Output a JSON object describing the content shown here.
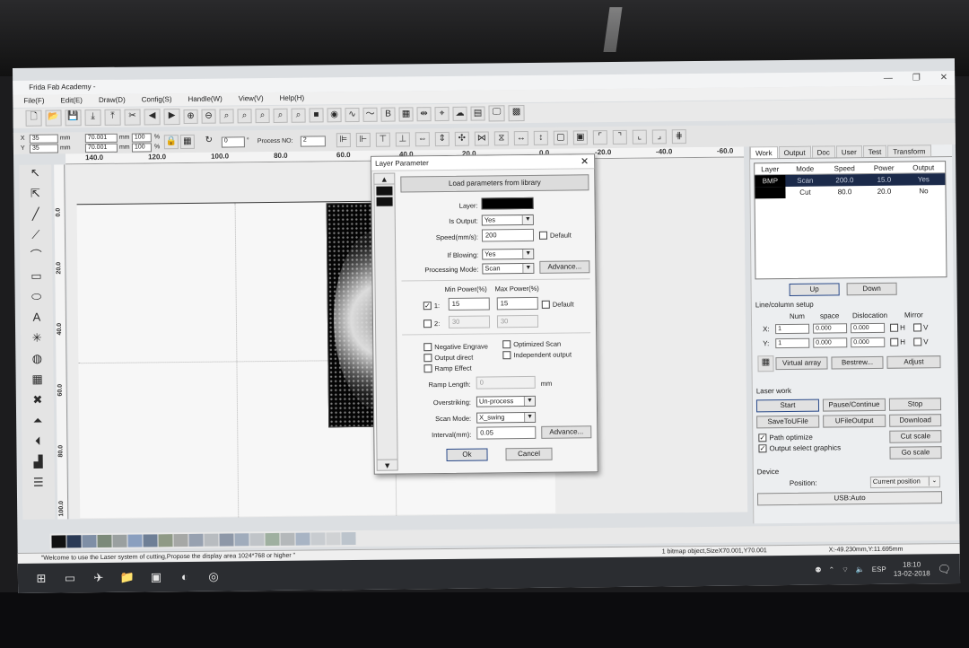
{
  "window": {
    "title": "Frida Fab Academy -"
  },
  "menu": [
    "File(F)",
    "Edit(E)",
    "Draw(D)",
    "Config(S)",
    "Handle(W)",
    "View(V)",
    "Help(H)"
  ],
  "coords": {
    "x_label": "X",
    "y_label": "Y",
    "x": "35",
    "y": "35",
    "unit": "mm",
    "w": "70.001",
    "h": "70.001",
    "pct_w": "100",
    "pct_h": "100",
    "pct": "%",
    "rotate": "0",
    "deg": "°",
    "process_label": "Process NO:",
    "process_no": "2"
  },
  "hruler": [
    "140.0",
    "120.0",
    "100.0",
    "80.0",
    "60.0",
    "40.0",
    "20.0",
    "0.0",
    "-20.0",
    "-40.0",
    "-60.0"
  ],
  "vruler": [
    "0.0",
    "20.0",
    "40.0",
    "60.0",
    "80.0",
    "100.0"
  ],
  "dialog": {
    "title": "Layer Parameter",
    "load_btn": "Load parameters from library",
    "layer_label": "Layer:",
    "is_output_label": "Is Output:",
    "is_output": "Yes",
    "speed_label": "Speed(mm/s):",
    "speed": "200",
    "default_label": "Default",
    "blowing_label": "If Blowing:",
    "blowing": "Yes",
    "mode_label": "Processing Mode:",
    "mode": "Scan",
    "advance": "Advance...",
    "min_power_label": "Min Power(%)",
    "max_power_label": "Max Power(%)",
    "row1_label": "1:",
    "min1": "15",
    "max1": "15",
    "row2_label": "2:",
    "min2": "30",
    "max2": "30",
    "negative": "Negative Engrave",
    "optimized": "Optimized Scan",
    "output_direct": "Output direct",
    "independent": "Independent output",
    "ramp_effect": "Ramp Effect",
    "ramp_length_label": "Ramp Length:",
    "ramp_length": "0",
    "mm": "mm",
    "overstriking_label": "Overstriking:",
    "overstriking": "Un-process",
    "scan_mode_label": "Scan Mode:",
    "scan_mode": "X_swing",
    "interval_label": "Interval(mm):",
    "interval": "0.05",
    "ok": "Ok",
    "cancel": "Cancel"
  },
  "right_panel": {
    "tabs": [
      "Work",
      "Output",
      "Doc",
      "User",
      "Test",
      "Transform"
    ],
    "table_headers": [
      "Layer",
      "Mode",
      "Speed",
      "Power",
      "Output"
    ],
    "rows": [
      {
        "layer": "BMP",
        "mode": "Scan",
        "speed": "200.0",
        "power": "15.0",
        "output": "Yes"
      },
      {
        "layer": "",
        "mode": "Cut",
        "speed": "80.0",
        "power": "20.0",
        "output": "No"
      }
    ],
    "up": "Up",
    "down": "Down",
    "line_setup": "Line/column setup",
    "num": "Num",
    "space": "space",
    "dislocation": "Dislocation",
    "mirror": "Mirror",
    "x_label": "X:",
    "y_label": "Y:",
    "x_num": "1",
    "x_space": "0.000",
    "x_disl": "0.000",
    "y_num": "1",
    "y_space": "0.000",
    "y_disl": "0.000",
    "h": "H",
    "v": "V",
    "virtual_array": "Virtual array",
    "bestrew": "Bestrew...",
    "adjust": "Adjust",
    "laser_work": "Laser work",
    "start": "Start",
    "pause": "Pause/Continue",
    "stop": "Stop",
    "save_ufile": "SaveToUFile",
    "ufile_output": "UFileOutput",
    "download": "Download",
    "path_optimize": "Path optimize",
    "output_select": "Output select graphics",
    "cut_scale": "Cut scale",
    "go_scale": "Go scale",
    "device": "Device",
    "position_label": "Position:",
    "position": "Current position",
    "usb": "USB:Auto"
  },
  "status": {
    "message": "\"Welcome to use the Laser system of cutting,Propose the display area 1024*768 or higher \"",
    "object": "1 bitmap object,SizeX70.001,Y70.001",
    "cursor": "X:-49.230mm,Y:11.695mm"
  },
  "tray": {
    "lang": "ESP",
    "time": "18:10",
    "date": "13-02-2018"
  },
  "palette": [
    "#111111",
    "#2b3a55",
    "#7f8fa6",
    "#7c8a7a",
    "#9aa0a0",
    "#8a9fbf",
    "#6e7f96",
    "#8f9a86",
    "#a6a8a6",
    "#97a1b0",
    "#b8bcc0",
    "#8e98a8",
    "#a0acbc",
    "#c0c4c8",
    "#9fb0a0",
    "#b4b8ba",
    "#a8b4c4",
    "#c8ccd0",
    "#d0d2d4",
    "#bcc4cc"
  ]
}
